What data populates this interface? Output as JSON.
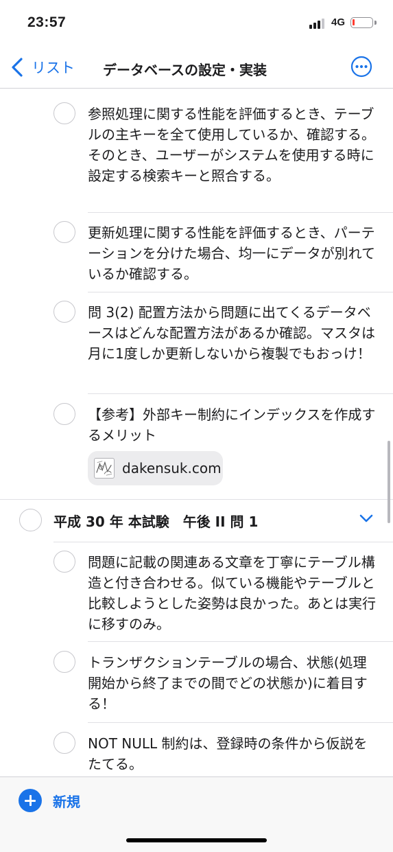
{
  "status_bar": {
    "time": "23:57",
    "network": "4G"
  },
  "nav": {
    "back_label": "リスト",
    "title": "データベースの設定・実装"
  },
  "items_top": [
    {
      "text": "参照処理に関する性能を評価するとき、テーブルの主キーを全て使用しているか、確認する。そのとき、ユーザーがシステムを使用する時に設定する検索キーと照合する。"
    },
    {
      "text": "更新処理に関する性能を評価するとき、パーテーションを分けた場合、均一にデータが別れているか確認する。"
    },
    {
      "text": "問 3(2) 配置方法から問題に出てくるデータベースはどんな配置方法があるか確認。マスタは月に1度しか更新しないから複製でもおっけ！"
    },
    {
      "text": "【参考】外部キー制約にインデックスを作成するメリット"
    }
  ],
  "link": {
    "label": "dakensuk.com"
  },
  "section": {
    "title": "平成 30 年 本試験　午後 II 問 1"
  },
  "items_bottom": [
    {
      "text": "問題に記載の関連ある文章を丁寧にテーブル構造と付き合わせる。似ている機能やテーブルと比較しようとした姿勢は良かった。あとは実行に移すのみ。"
    },
    {
      "text": "トランザクションテーブルの場合、状態(処理開始から終了までの間でどの状態か)に着目する！"
    },
    {
      "text": "NOT NULL 制約は、登録時の条件から仮説をたてる。"
    }
  ],
  "toolbar": {
    "new_label": "新規"
  },
  "colors": {
    "accent": "#1a73e8",
    "battery_low": "#ff3b30"
  }
}
